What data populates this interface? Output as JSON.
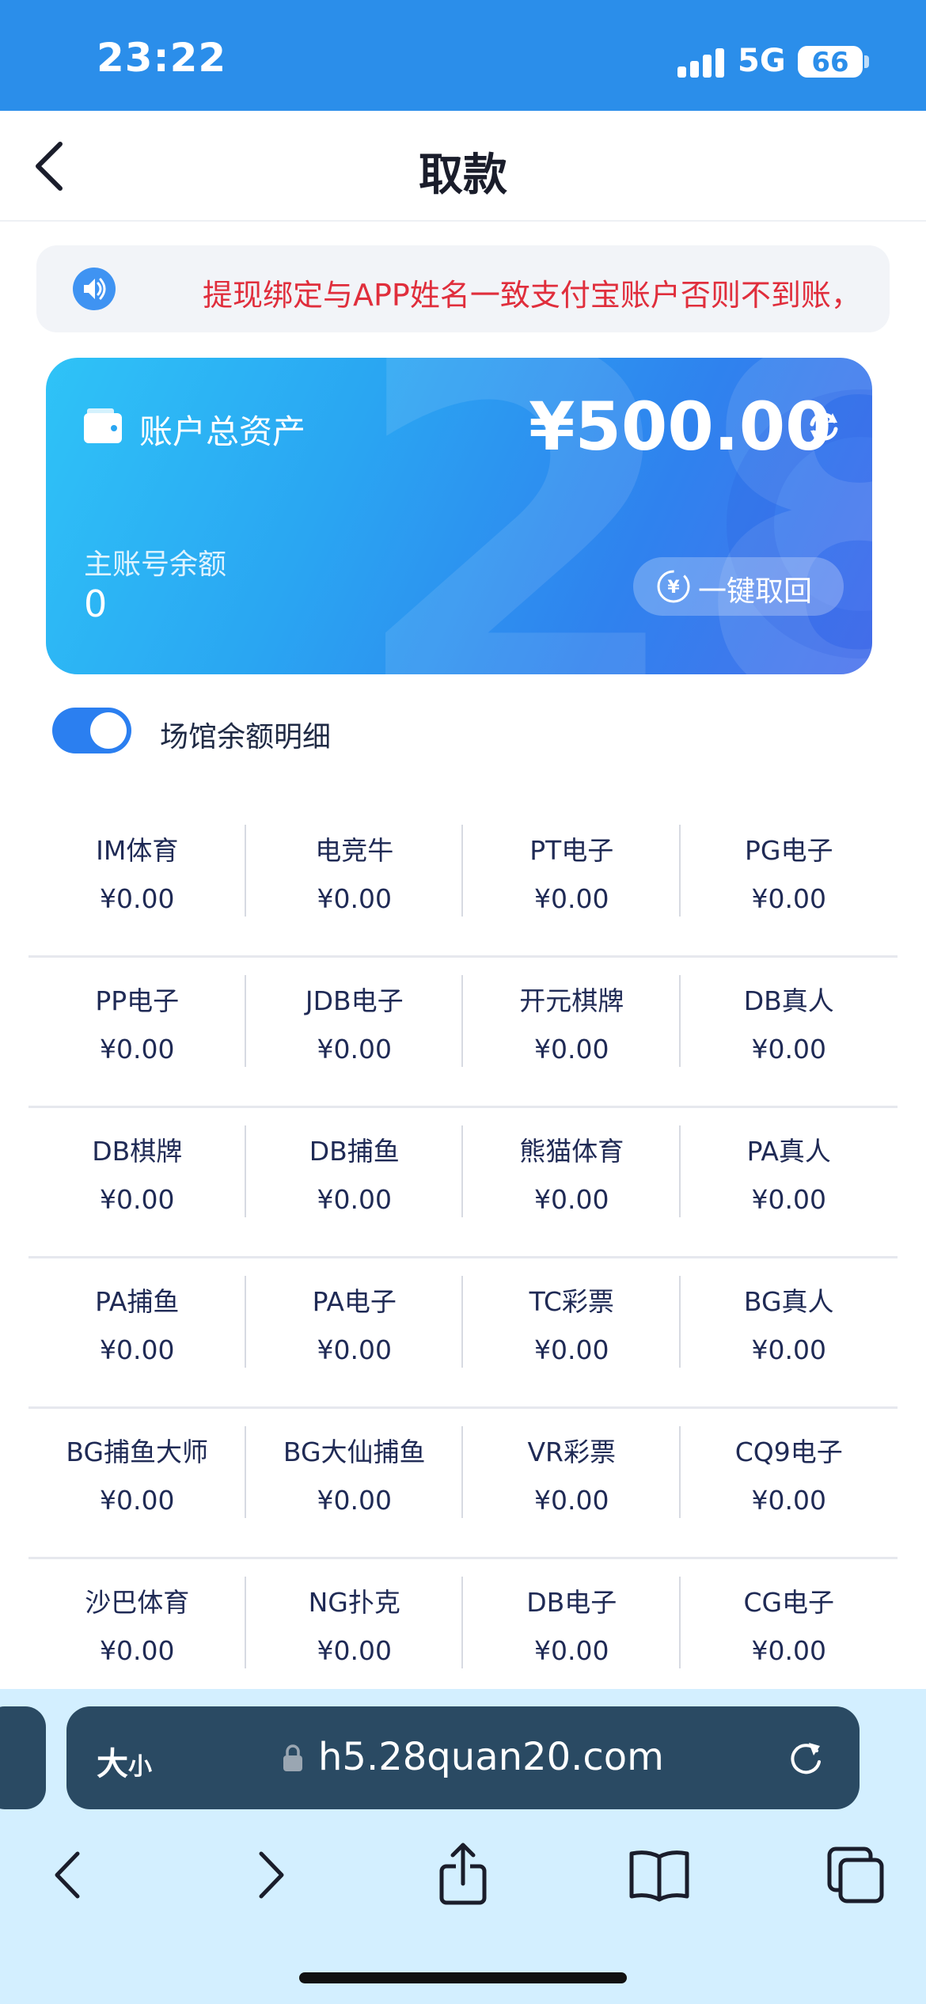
{
  "status_bar": {
    "time": "23:22",
    "network": "5G",
    "battery": "66"
  },
  "nav": {
    "title": "取款"
  },
  "notice": {
    "text": "提现绑定与APP姓名一致支付宝账户否则不到账，"
  },
  "asset_card": {
    "label": "账户总资产",
    "amount": "¥500.00",
    "main_label": "主账号余额",
    "main_value": "0",
    "recall_label": "一键取回",
    "watermark": "28"
  },
  "toggle": {
    "label": "场馆余额明细",
    "on": true
  },
  "venues": [
    [
      {
        "name": "IM体育",
        "amount": "¥0.00"
      },
      {
        "name": "电竞牛",
        "amount": "¥0.00"
      },
      {
        "name": "PT电子",
        "amount": "¥0.00"
      },
      {
        "name": "PG电子",
        "amount": "¥0.00"
      }
    ],
    [
      {
        "name": "PP电子",
        "amount": "¥0.00"
      },
      {
        "name": "JDB电子",
        "amount": "¥0.00"
      },
      {
        "name": "开元棋牌",
        "amount": "¥0.00"
      },
      {
        "name": "DB真人",
        "amount": "¥0.00"
      }
    ],
    [
      {
        "name": "DB棋牌",
        "amount": "¥0.00"
      },
      {
        "name": "DB捕鱼",
        "amount": "¥0.00"
      },
      {
        "name": "熊猫体育",
        "amount": "¥0.00"
      },
      {
        "name": "PA真人",
        "amount": "¥0.00"
      }
    ],
    [
      {
        "name": "PA捕鱼",
        "amount": "¥0.00"
      },
      {
        "name": "PA电子",
        "amount": "¥0.00"
      },
      {
        "name": "TC彩票",
        "amount": "¥0.00"
      },
      {
        "name": "BG真人",
        "amount": "¥0.00"
      }
    ],
    [
      {
        "name": "BG捕鱼大师",
        "amount": "¥0.00"
      },
      {
        "name": "BG大仙捕鱼",
        "amount": "¥0.00"
      },
      {
        "name": "VR彩票",
        "amount": "¥0.00"
      },
      {
        "name": "CQ9电子",
        "amount": "¥0.00"
      }
    ],
    [
      {
        "name": "沙巴体育",
        "amount": "¥0.00"
      },
      {
        "name": "NG扑克",
        "amount": "¥0.00"
      },
      {
        "name": "DB电子",
        "amount": "¥0.00"
      },
      {
        "name": "CG电子",
        "amount": "¥0.00"
      }
    ]
  ],
  "browser": {
    "size_label": "大",
    "size_label_small": "小",
    "url": "h5.28quan20.com",
    "toolbar_icons": [
      "back-icon",
      "forward-icon",
      "share-icon",
      "bookmarks-icon",
      "tabs-icon"
    ]
  },
  "colors": {
    "status_bar": "#2b8eea",
    "accent": "#2b7ff0",
    "notice_text": "#e02e3c",
    "browser_bar": "#2a4a63"
  }
}
